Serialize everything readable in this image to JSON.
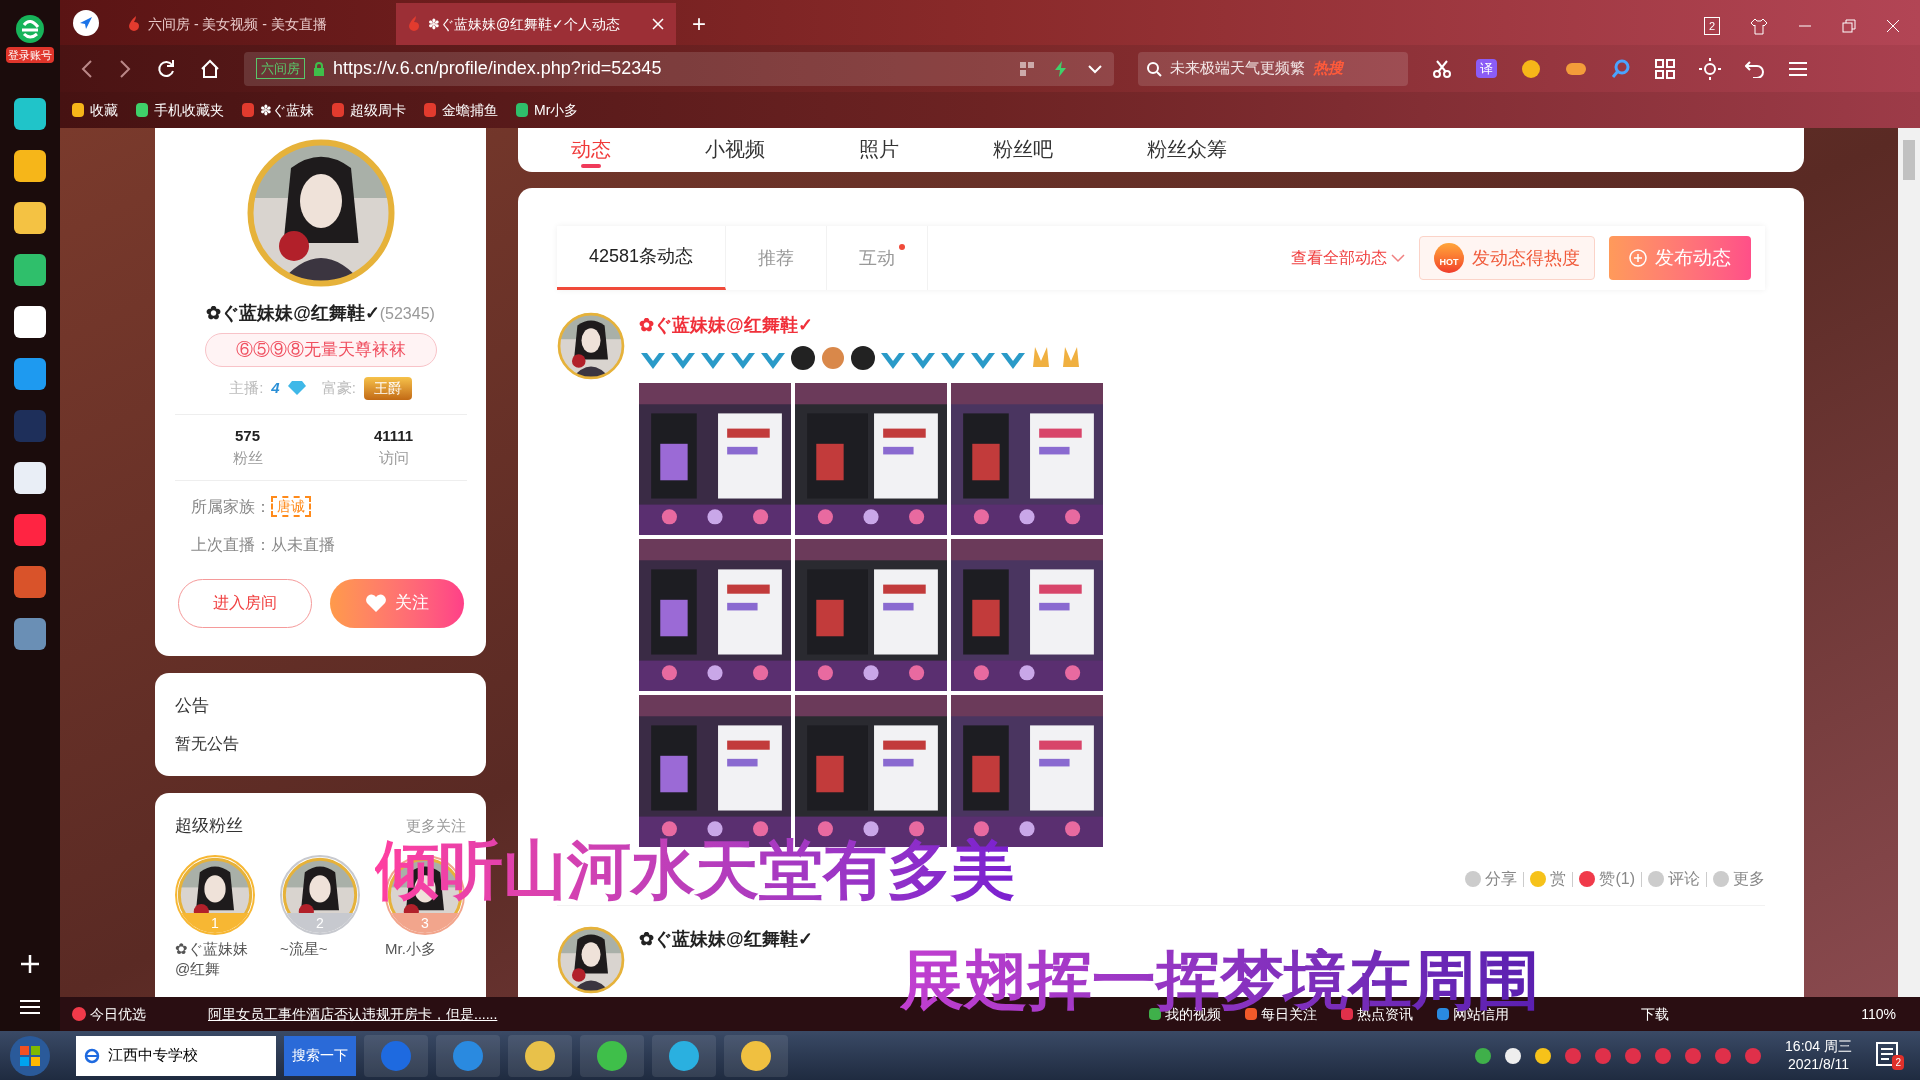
{
  "browser": {
    "login": "登录账号",
    "tabs": [
      {
        "title": "六间房 - 美女视频 - 美女直播",
        "selected": false
      },
      {
        "title": "✽ぐ蓝妹妹@红舞鞋✓个人动态",
        "selected": true
      }
    ],
    "new_tab": "+",
    "window_count": "2",
    "address": {
      "site": "六间房",
      "url": "https://v.6.cn/profile/index.php?rid=52345"
    },
    "search": {
      "placeholder": "未来极端天气更频繁",
      "hot": "热搜"
    },
    "translate": "译",
    "bookmarks": [
      "收藏",
      "手机收藏夹",
      "✽ぐ蓝妹",
      "超级周卡",
      "金蟾捕鱼",
      "Mr小多"
    ]
  },
  "profile": {
    "name": "✿ぐ蓝妹妹@红舞鞋✓",
    "uid": "(52345)",
    "badge": "⑥⑤⑨⑧无量天尊袜袜",
    "host_label": "主播:",
    "host_level": "4",
    "rich_label": "富豪:",
    "rich_badge": "王爵",
    "stats": [
      {
        "value": "575",
        "label": "粉丝"
      },
      {
        "value": "41111",
        "label": "访问"
      }
    ],
    "family_label": "所属家族：",
    "family": "唐诚",
    "last_live": "上次直播：从未直播",
    "enter_button": "进入房间",
    "follow_button": "关注"
  },
  "notice": {
    "title": "公告",
    "text": "暂无公告"
  },
  "fans": {
    "title": "超级粉丝",
    "more": "更多关注",
    "items": [
      {
        "rank": "1",
        "name": "✿ぐ蓝妹妹@红舞",
        "color": "#f7b733"
      },
      {
        "rank": "2",
        "name": "~流星~",
        "color": "#c7c9cf"
      },
      {
        "rank": "3",
        "name": "Mr.小多",
        "color": "#f2a58c"
      }
    ]
  },
  "nav_tabs": [
    {
      "label": "动态",
      "selected": true
    },
    {
      "label": "小视频",
      "selected": false
    },
    {
      "label": "照片",
      "selected": false
    },
    {
      "label": "粉丝吧",
      "selected": false
    },
    {
      "label": "粉丝众筹",
      "selected": false
    }
  ],
  "feed_tabs": [
    {
      "label": "42581条动态",
      "selected": true,
      "dot": false
    },
    {
      "label": "推荐",
      "selected": false,
      "dot": false
    },
    {
      "label": "互动",
      "selected": false,
      "dot": true
    }
  ],
  "view_all": "查看全部动态",
  "hot_badge": "HOT",
  "hot_button": "发动态得热度",
  "publish_button": "发布动态",
  "posts": [
    {
      "author": "✿ぐ蓝妹妹@红舞鞋✓",
      "photos": [
        {
          "kind": "picture"
        },
        {
          "kind": "picture"
        },
        {
          "kind": "picture"
        },
        {
          "kind": "picture"
        },
        {
          "kind": "picture"
        },
        {
          "kind": "picture"
        },
        {
          "kind": "picture"
        },
        {
          "kind": "picture"
        },
        {
          "kind": "picture"
        }
      ],
      "actions": [
        "分享",
        "赏",
        "赞(1)",
        "评论",
        "更多"
      ]
    },
    {
      "author": "✿ぐ蓝妹妹@红舞鞋✓"
    }
  ],
  "lyrics": [
    "倾听山河水天堂有多美",
    "展翅挥一挥梦境在周围"
  ],
  "status_bar": {
    "today": "今日优选",
    "headline": "阿里女员工事件酒店否认违规开房卡，但是......",
    "links": [
      "我的视频",
      "每日关注",
      "热点资讯",
      "网站信用"
    ],
    "download": "下载",
    "zoom": "110%"
  },
  "taskbar": {
    "search_value": "江西中专学校",
    "search_button": "搜索一下",
    "time": "16:04 周三",
    "date": "2021/8/11",
    "notifications": "2"
  }
}
